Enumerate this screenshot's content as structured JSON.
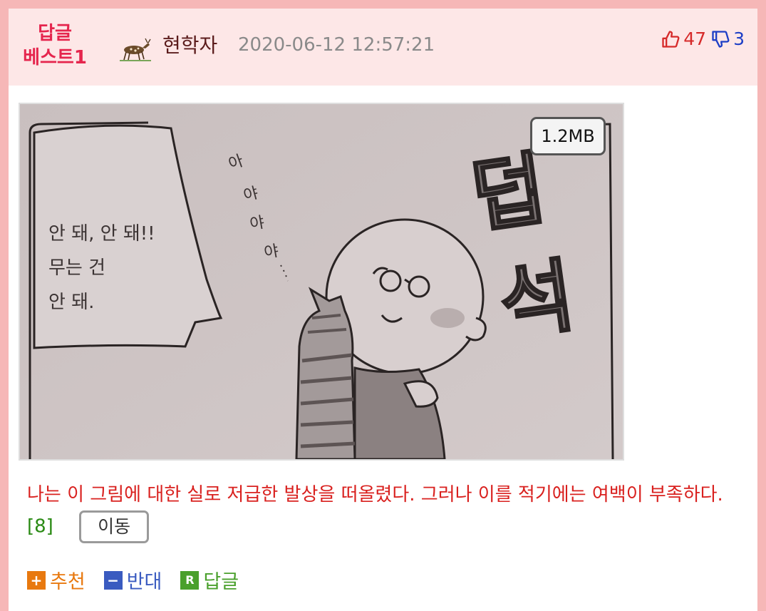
{
  "header": {
    "badge_line1": "답글",
    "badge_line2": "베스트1",
    "author": "현학자",
    "timestamp": "2020-06-12 12:57:21",
    "upvotes": "47",
    "downvotes": "3"
  },
  "image": {
    "size_label": "1.2MB",
    "bubble_line1": "안 돼, 안 돼!!",
    "bubble_line2": "무는 건",
    "bubble_line3": "안 돼.",
    "sfx_a1": "아",
    "sfx_a2": "야",
    "sfx_a3": "야",
    "sfx_a4": "야",
    "sfx_big1": "덥",
    "sfx_big2": "석"
  },
  "post": {
    "text": "나는 이 그림에 대한 실로 저급한 발상을 떠올렸다. 그러나 이를 적기에는 여백이 부족하다.",
    "ref": "[8]",
    "move_label": "이동"
  },
  "actions": {
    "recommend": "추천",
    "oppose": "반대",
    "reply": "답글"
  },
  "colors": {
    "border": "#f6b7b7",
    "header_bg": "#fde7e7",
    "badge": "#e5254d",
    "body_text": "#d9211f",
    "ref": "#2a8a14"
  }
}
